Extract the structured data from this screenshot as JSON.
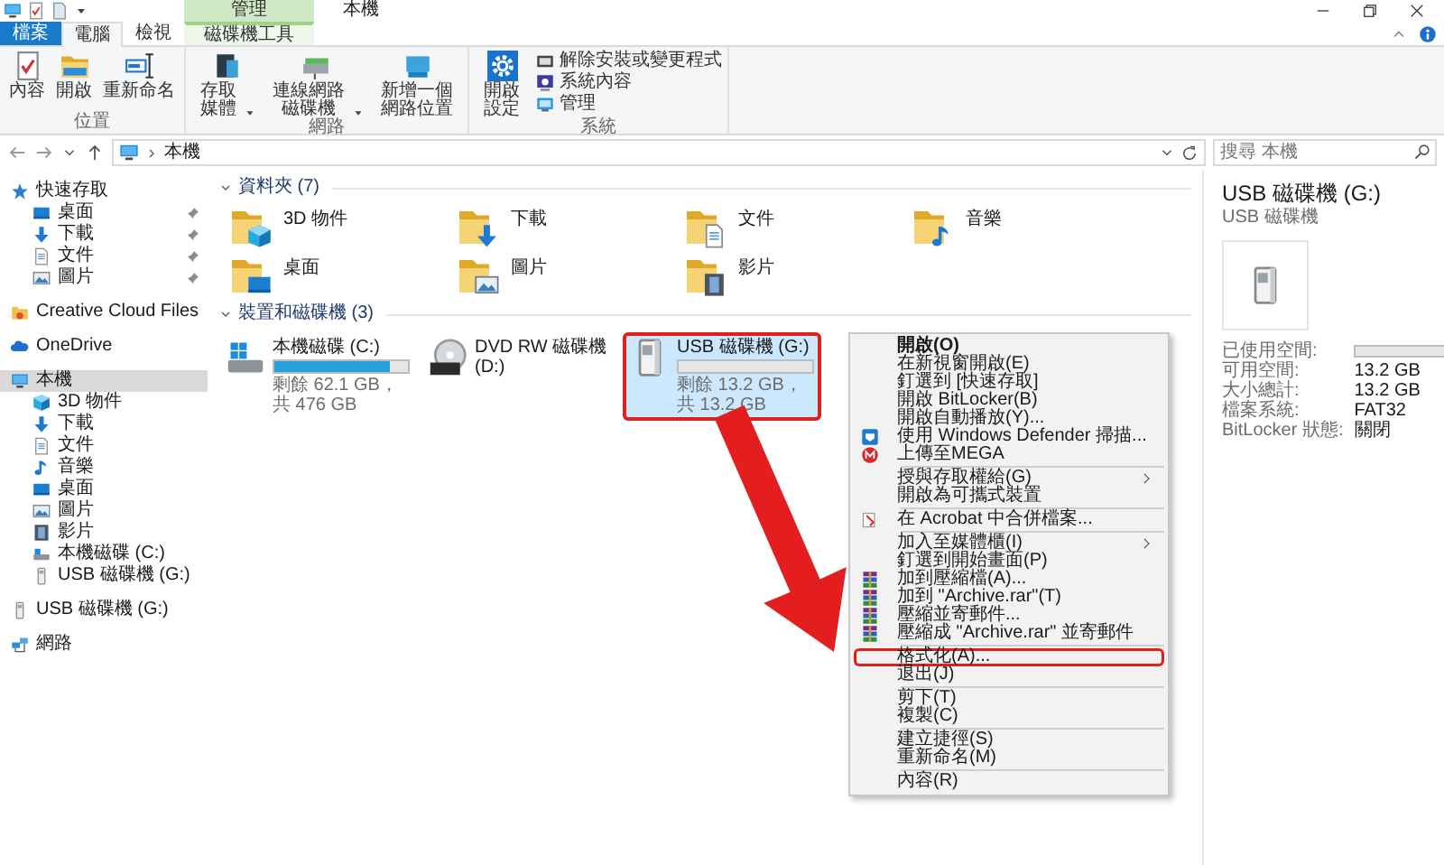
{
  "window": {
    "title": "本機",
    "context_tab_group": "管理"
  },
  "ribbon": {
    "tabs": [
      {
        "label": "檔案",
        "kind": "file",
        "selected": false
      },
      {
        "label": "電腦",
        "kind": "tab",
        "selected": true
      },
      {
        "label": "檢視",
        "kind": "tab",
        "selected": false
      },
      {
        "label": "磁碟機工具",
        "kind": "context",
        "selected": false
      }
    ],
    "groups": [
      {
        "name": "位置",
        "buttons": [
          {
            "label": "內容"
          },
          {
            "label": "開啟"
          },
          {
            "label": "重新命名"
          }
        ]
      },
      {
        "name": "網路",
        "buttons": [
          {
            "label": "存取媒體",
            "dropdown": true
          },
          {
            "label": "連線網路磁碟機",
            "dropdown": true
          },
          {
            "label": "新增一個網路位置",
            "dropdown": false
          }
        ]
      },
      {
        "name": "系統",
        "buttons": [
          {
            "label": "開啟設定"
          }
        ],
        "small_buttons": [
          {
            "label": "解除安裝或變更程式"
          },
          {
            "label": "系統內容"
          },
          {
            "label": "管理"
          }
        ]
      }
    ]
  },
  "address_bar": {
    "path": "本機",
    "search": {
      "placeholder": "搜尋 本機"
    }
  },
  "nav_pane": {
    "items": [
      {
        "label": "快速存取",
        "selected": false,
        "pinned": false,
        "children": [
          {
            "label": "桌面",
            "selected": false,
            "pinned": true
          },
          {
            "label": "下載",
            "selected": false,
            "pinned": true
          },
          {
            "label": "文件",
            "selected": false,
            "pinned": true
          },
          {
            "label": "圖片",
            "selected": false,
            "pinned": true
          }
        ]
      },
      {
        "label": "Creative Cloud Files",
        "selected": false,
        "pinned": false
      },
      {
        "label": "OneDrive",
        "selected": false,
        "pinned": false
      },
      {
        "label": "本機",
        "selected": true,
        "pinned": false,
        "children": [
          {
            "label": "3D 物件",
            "selected": false,
            "pinned": false
          },
          {
            "label": "下載",
            "selected": false,
            "pinned": false
          },
          {
            "label": "文件",
            "selected": false,
            "pinned": false
          },
          {
            "label": "音樂",
            "selected": false,
            "pinned": false
          },
          {
            "label": "桌面",
            "selected": false,
            "pinned": false
          },
          {
            "label": "圖片",
            "selected": false,
            "pinned": false
          },
          {
            "label": "影片",
            "selected": false,
            "pinned": false
          },
          {
            "label": "本機磁碟 (C:)",
            "selected": false,
            "pinned": false
          },
          {
            "label": "USB 磁碟機 (G:)",
            "selected": false,
            "pinned": false
          }
        ]
      },
      {
        "label": "USB 磁碟機 (G:)",
        "selected": false,
        "pinned": false
      },
      {
        "label": "網路",
        "selected": false,
        "pinned": false
      }
    ]
  },
  "content": {
    "folders": {
      "title": "資料夾 (7)",
      "items": [
        {
          "name": "3D 物件"
        },
        {
          "name": "下載"
        },
        {
          "name": "文件"
        },
        {
          "name": "音樂"
        },
        {
          "name": "桌面"
        },
        {
          "name": "圖片"
        },
        {
          "name": "影片"
        }
      ]
    },
    "drives": {
      "title": "裝置和磁碟機 (3)",
      "items": [
        {
          "name": "本機磁碟 (C:)",
          "level": 0.87,
          "free": "剩餘 62.1 GB，共 476 GB",
          "selected": false,
          "annotated": false
        },
        {
          "name": "DVD RW 磁碟機 (D:)",
          "selected": false,
          "annotated": false
        },
        {
          "name": "USB 磁碟機 (G:)",
          "level": 0,
          "free": "剩餘 13.2 GB，共 13.2 GB",
          "selected": true,
          "annotated": true
        }
      ]
    }
  },
  "details": {
    "title": "USB 磁碟機 (G:)",
    "subtitle": "USB 磁碟機",
    "properties": [
      {
        "label": "已使用空間:",
        "level": 0
      },
      {
        "label": "可用空間:",
        "value": "13.2 GB"
      },
      {
        "label": "大小總計:",
        "value": "13.2 GB"
      },
      {
        "label": "檔案系統:",
        "value": "FAT32"
      },
      {
        "label": "BitLocker 狀態:",
        "value": "關閉"
      }
    ]
  },
  "context_menu": {
    "items": [
      {
        "kind": "item",
        "label": "開啟(O)",
        "default": true,
        "annotated": false
      },
      {
        "kind": "item",
        "label": "在新視窗開啟(E)",
        "default": false,
        "annotated": false
      },
      {
        "kind": "item",
        "label": "釘選到 [快速存取]",
        "default": false,
        "annotated": false
      },
      {
        "kind": "item",
        "label": "開啟 BitLocker(B)",
        "default": false,
        "annotated": false
      },
      {
        "kind": "item",
        "label": "開啟自動播放(Y)...",
        "default": false,
        "annotated": false
      },
      {
        "kind": "item",
        "label": "使用 Windows Defender 掃描...",
        "default": false,
        "annotated": false
      },
      {
        "kind": "item",
        "label": "上傳至MEGA",
        "default": false,
        "annotated": false
      },
      {
        "kind": "separator"
      },
      {
        "kind": "submenu",
        "label": "授與存取權給(G)",
        "default": false,
        "annotated": false
      },
      {
        "kind": "item",
        "label": "開啟為可攜式裝置",
        "default": false,
        "annotated": false
      },
      {
        "kind": "separator"
      },
      {
        "kind": "item",
        "label": "在 Acrobat 中合併檔案...",
        "default": false,
        "annotated": false
      },
      {
        "kind": "separator"
      },
      {
        "kind": "submenu",
        "label": "加入至媒體櫃(I)",
        "default": false,
        "annotated": false
      },
      {
        "kind": "item",
        "label": "釘選到開始畫面(P)",
        "default": false,
        "annotated": false
      },
      {
        "kind": "item",
        "label": "加到壓縮檔(A)...",
        "default": false,
        "annotated": false
      },
      {
        "kind": "item",
        "label": "加到 \"Archive.rar\"(T)",
        "default": false,
        "annotated": false
      },
      {
        "kind": "item",
        "label": "壓縮並寄郵件...",
        "default": false,
        "annotated": false
      },
      {
        "kind": "item",
        "label": "壓縮成 \"Archive.rar\" 並寄郵件",
        "default": false,
        "annotated": false
      },
      {
        "kind": "separator"
      },
      {
        "kind": "item",
        "label": "格式化(A)...",
        "default": false,
        "annotated": true
      },
      {
        "kind": "item",
        "label": "退出(J)",
        "default": false,
        "annotated": false
      },
      {
        "kind": "separator"
      },
      {
        "kind": "item",
        "label": "剪下(T)",
        "default": false,
        "annotated": false
      },
      {
        "kind": "item",
        "label": "複製(C)",
        "default": false,
        "annotated": false
      },
      {
        "kind": "separator"
      },
      {
        "kind": "item",
        "label": "建立捷徑(S)",
        "default": false,
        "annotated": false
      },
      {
        "kind": "item",
        "label": "重新命名(M)",
        "default": false,
        "annotated": false
      },
      {
        "kind": "separator"
      },
      {
        "kind": "item",
        "label": "內容(R)",
        "default": false,
        "annotated": false
      }
    ]
  }
}
